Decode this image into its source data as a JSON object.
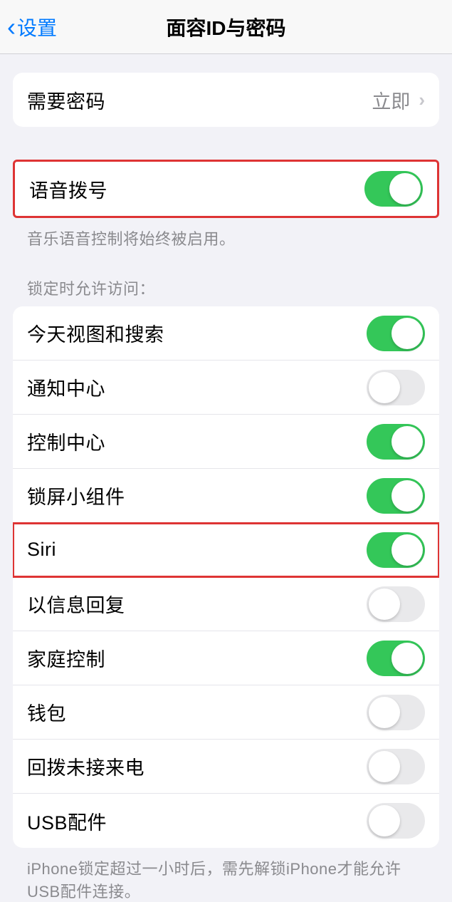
{
  "nav": {
    "back_label": "设置",
    "title": "面容ID与密码"
  },
  "require_passcode": {
    "label": "需要密码",
    "value": "立即"
  },
  "voice_dial": {
    "label": "语音拨号",
    "on": true,
    "footer": "音乐语音控制将始终被启用。"
  },
  "lock_access": {
    "header": "锁定时允许访问：",
    "items": [
      {
        "label": "今天视图和搜索",
        "on": true,
        "highlighted": false
      },
      {
        "label": "通知中心",
        "on": false,
        "highlighted": false
      },
      {
        "label": "控制中心",
        "on": true,
        "highlighted": false
      },
      {
        "label": "锁屏小组件",
        "on": true,
        "highlighted": false
      },
      {
        "label": "Siri",
        "on": true,
        "highlighted": true
      },
      {
        "label": "以信息回复",
        "on": false,
        "highlighted": false
      },
      {
        "label": "家庭控制",
        "on": true,
        "highlighted": false
      },
      {
        "label": "钱包",
        "on": false,
        "highlighted": false
      },
      {
        "label": "回拨未接来电",
        "on": false,
        "highlighted": false
      },
      {
        "label": "USB配件",
        "on": false,
        "highlighted": false
      }
    ],
    "footer": "iPhone锁定超过一小时后，需先解锁iPhone才能允许USB配件连接。"
  }
}
